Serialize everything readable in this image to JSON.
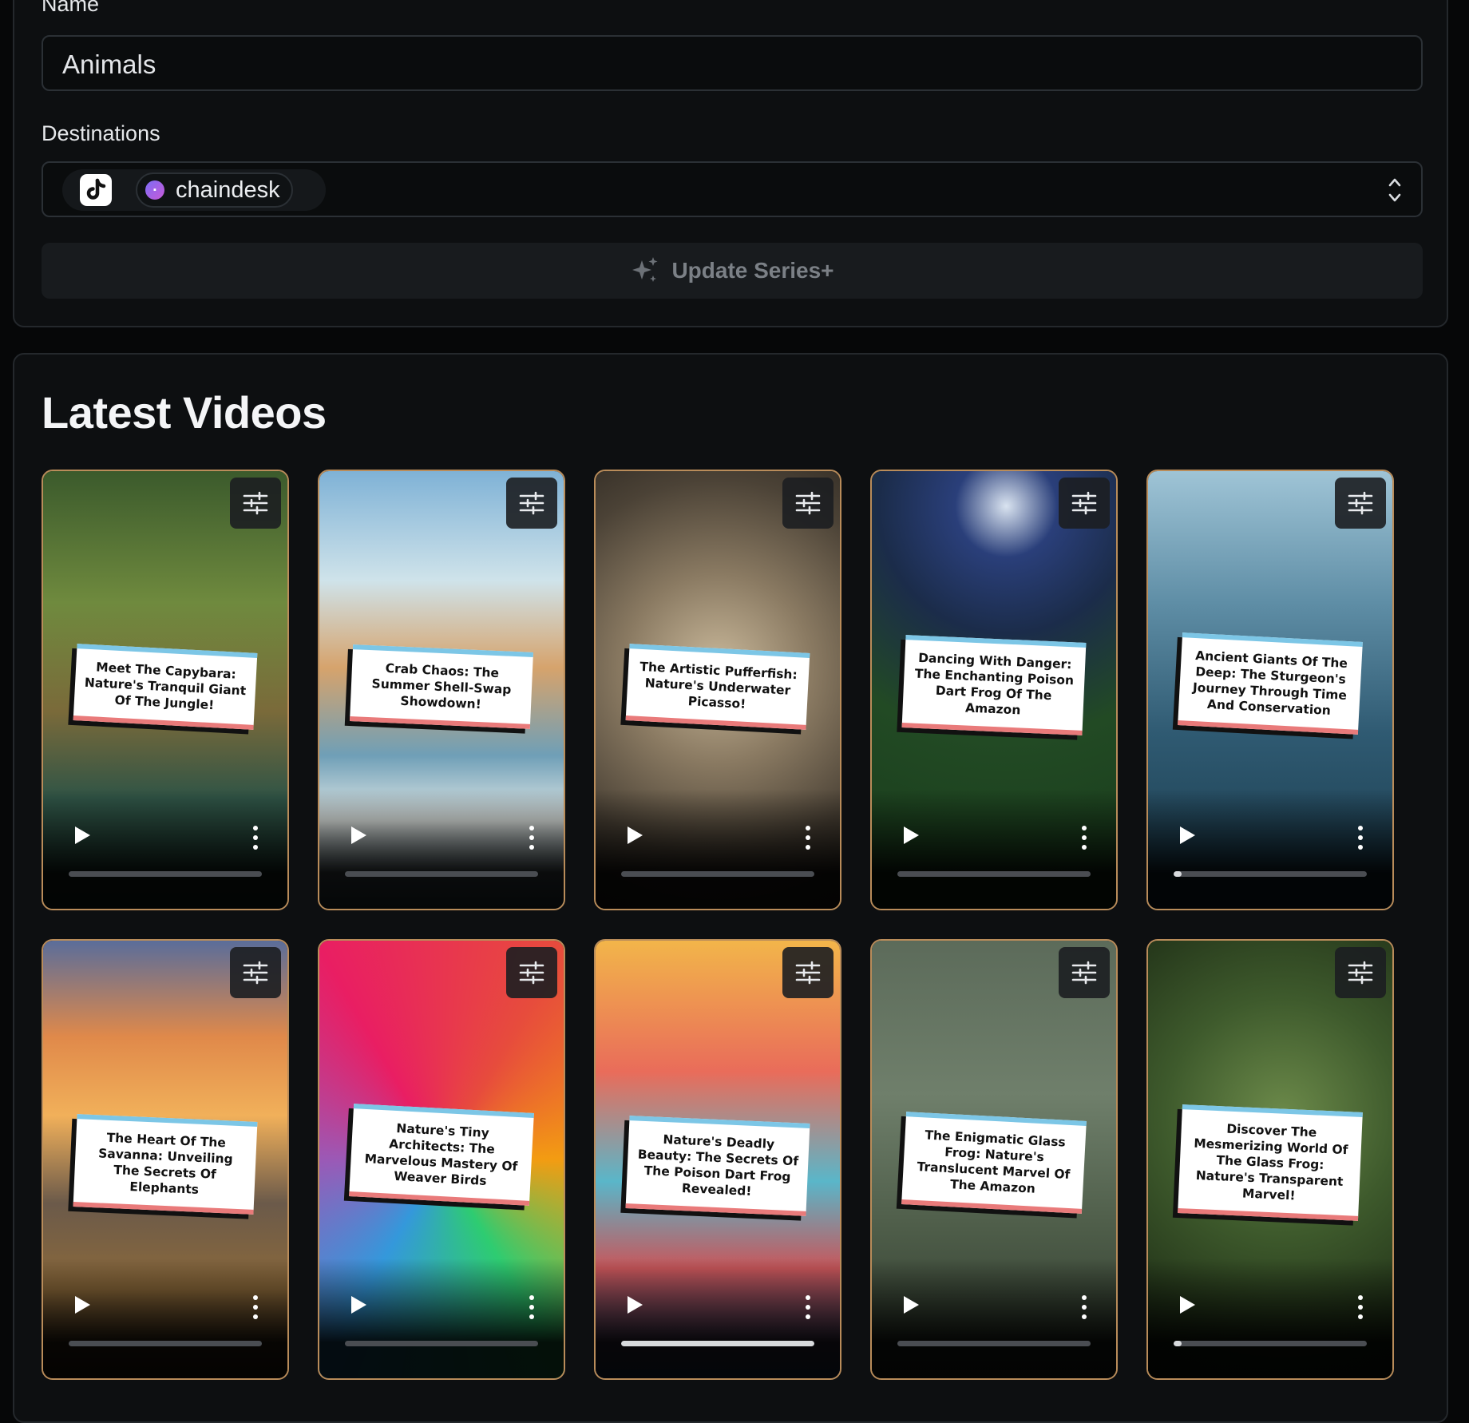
{
  "series_form": {
    "name_label": "Name",
    "name_value": "Animals",
    "destinations_label": "Destinations",
    "destinations": [
      {
        "platform": "TikTok",
        "icon": "tiktok-icon"
      },
      {
        "label": "chaindesk",
        "icon": "chaindesk-logo-icon"
      }
    ],
    "update_button_label": "Update Series+"
  },
  "latest_videos": {
    "title": "Latest Videos",
    "videos": [
      {
        "caption": "Meet The Capybara: Nature's Tranquil Giant Of The Jungle!",
        "progress": 0,
        "theme": "jungle"
      },
      {
        "caption": "Crab Chaos: The Summer Shell-Swap Showdown!",
        "progress": 0,
        "theme": "beach"
      },
      {
        "caption": "The Artistic Pufferfish: Nature's Underwater Picasso!",
        "progress": 0,
        "theme": "seabed"
      },
      {
        "caption": "Dancing With Danger: The Enchanting Poison Dart Frog Of The Amazon",
        "progress": 0,
        "theme": "night-jungle"
      },
      {
        "caption": "Ancient Giants Of The Deep: The Sturgeon's Journey Through Time And Conservation",
        "progress": 0.04,
        "theme": "underwater"
      },
      {
        "caption": "The Heart Of The Savanna: Unveiling The Secrets Of Elephants",
        "progress": 0,
        "theme": "savanna"
      },
      {
        "caption": "Nature's Tiny Architects: The Marvelous Mastery Of Weaver Birds",
        "progress": 0,
        "theme": "psychedelic"
      },
      {
        "caption": "Nature's Deadly Beauty: The Secrets Of The Poison Dart Frog Revealed!",
        "progress": 1,
        "theme": "cartoon-town"
      },
      {
        "caption": "The Enigmatic Glass Frog: Nature's Translucent Marvel Of The Amazon",
        "progress": 0,
        "theme": "rain"
      },
      {
        "caption": "Discover The Mesmerizing World Of The Glass Frog: Nature's Transparent Marvel!",
        "progress": 0.04,
        "theme": "leaf"
      }
    ]
  },
  "colors": {
    "card_border": "#b98c5a",
    "background": "#060708",
    "panel": "#0d0f11",
    "caption_top": "#7cc6e6",
    "caption_bottom": "#e97a7a"
  }
}
